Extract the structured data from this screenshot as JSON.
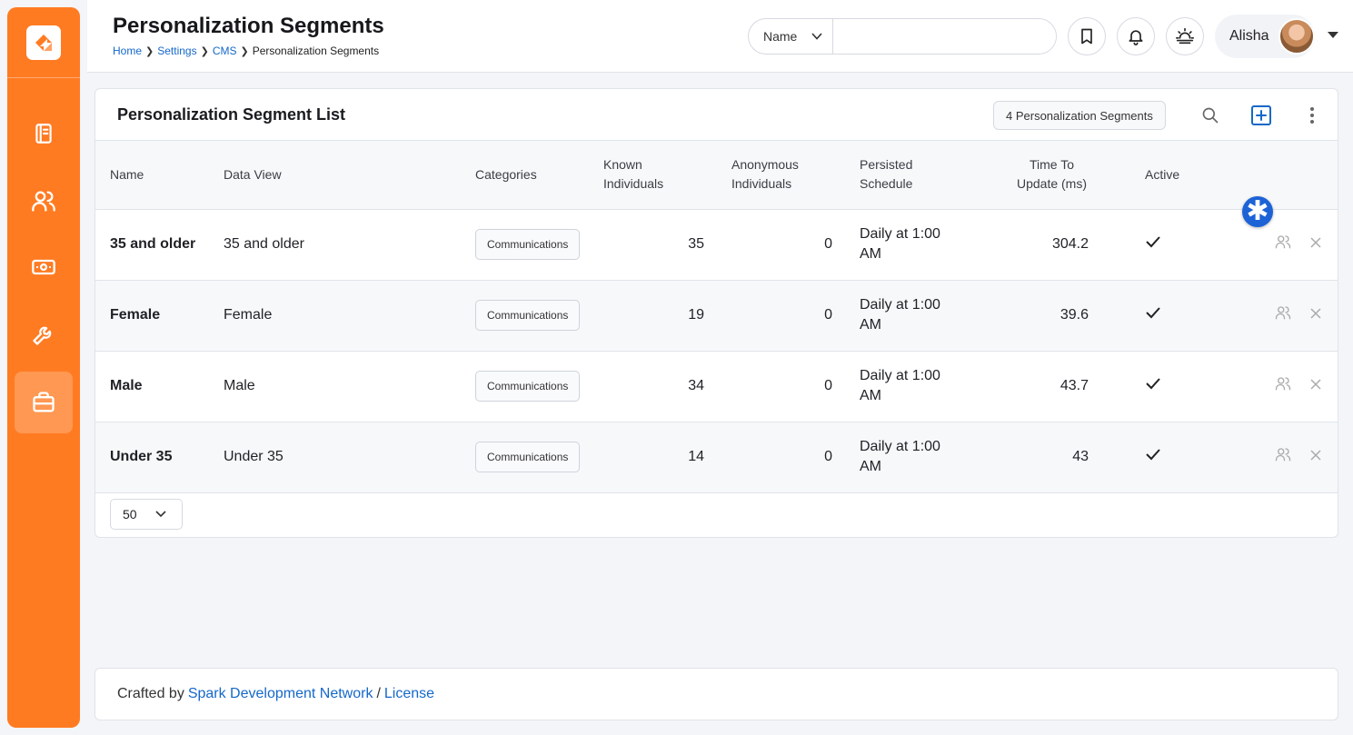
{
  "header": {
    "title": "Personalization Segments",
    "breadcrumb": [
      "Home",
      "Settings",
      "CMS",
      "Personalization Segments"
    ],
    "search_type": "Name",
    "search_value": "",
    "user_name": "Alisha"
  },
  "sidebar": {
    "items": [
      {
        "icon": "book-icon"
      },
      {
        "icon": "people-icon"
      },
      {
        "icon": "money-icon"
      },
      {
        "icon": "wrench-icon"
      },
      {
        "icon": "briefcase-icon",
        "active": true
      }
    ]
  },
  "card": {
    "title": "Personalization Segment List",
    "count_label": "4 Personalization Segments"
  },
  "table": {
    "columns": {
      "name": "Name",
      "data_view": "Data View",
      "categories": "Categories",
      "known_1": "Known",
      "known_2": "Individuals",
      "anon_1": "Anonymous",
      "anon_2": "Individuals",
      "persist_1": "Persisted",
      "persist_2": "Schedule",
      "time_1": "Time To",
      "time_2": "Update (ms)",
      "active": "Active"
    },
    "rows": [
      {
        "name": "35 and older",
        "data_view": "35 and older",
        "category": "Communications",
        "known": "35",
        "anonymous": "0",
        "schedule_1": "Daily at 1:00",
        "schedule_2": "AM",
        "time": "304.2",
        "active": true
      },
      {
        "name": "Female",
        "data_view": "Female",
        "category": "Communications",
        "known": "19",
        "anonymous": "0",
        "schedule_1": "Daily at 1:00",
        "schedule_2": "AM",
        "time": "39.6",
        "active": true
      },
      {
        "name": "Male",
        "data_view": "Male",
        "category": "Communications",
        "known": "34",
        "anonymous": "0",
        "schedule_1": "Daily at 1:00",
        "schedule_2": "AM",
        "time": "43.7",
        "active": true
      },
      {
        "name": "Under 35",
        "data_view": "Under 35",
        "category": "Communications",
        "known": "14",
        "anonymous": "0",
        "schedule_1": "Daily at 1:00",
        "schedule_2": "AM",
        "time": "43",
        "active": true
      }
    ],
    "page_size": "50"
  },
  "marker": {
    "symbol": "✱"
  },
  "footer": {
    "prefix": "Crafted by",
    "org_link": "Spark Development Network",
    "sep": "/",
    "license_link": "License"
  },
  "colors": {
    "accent": "#ff7b22",
    "link": "#1568c9",
    "marker": "#1d63d6"
  }
}
